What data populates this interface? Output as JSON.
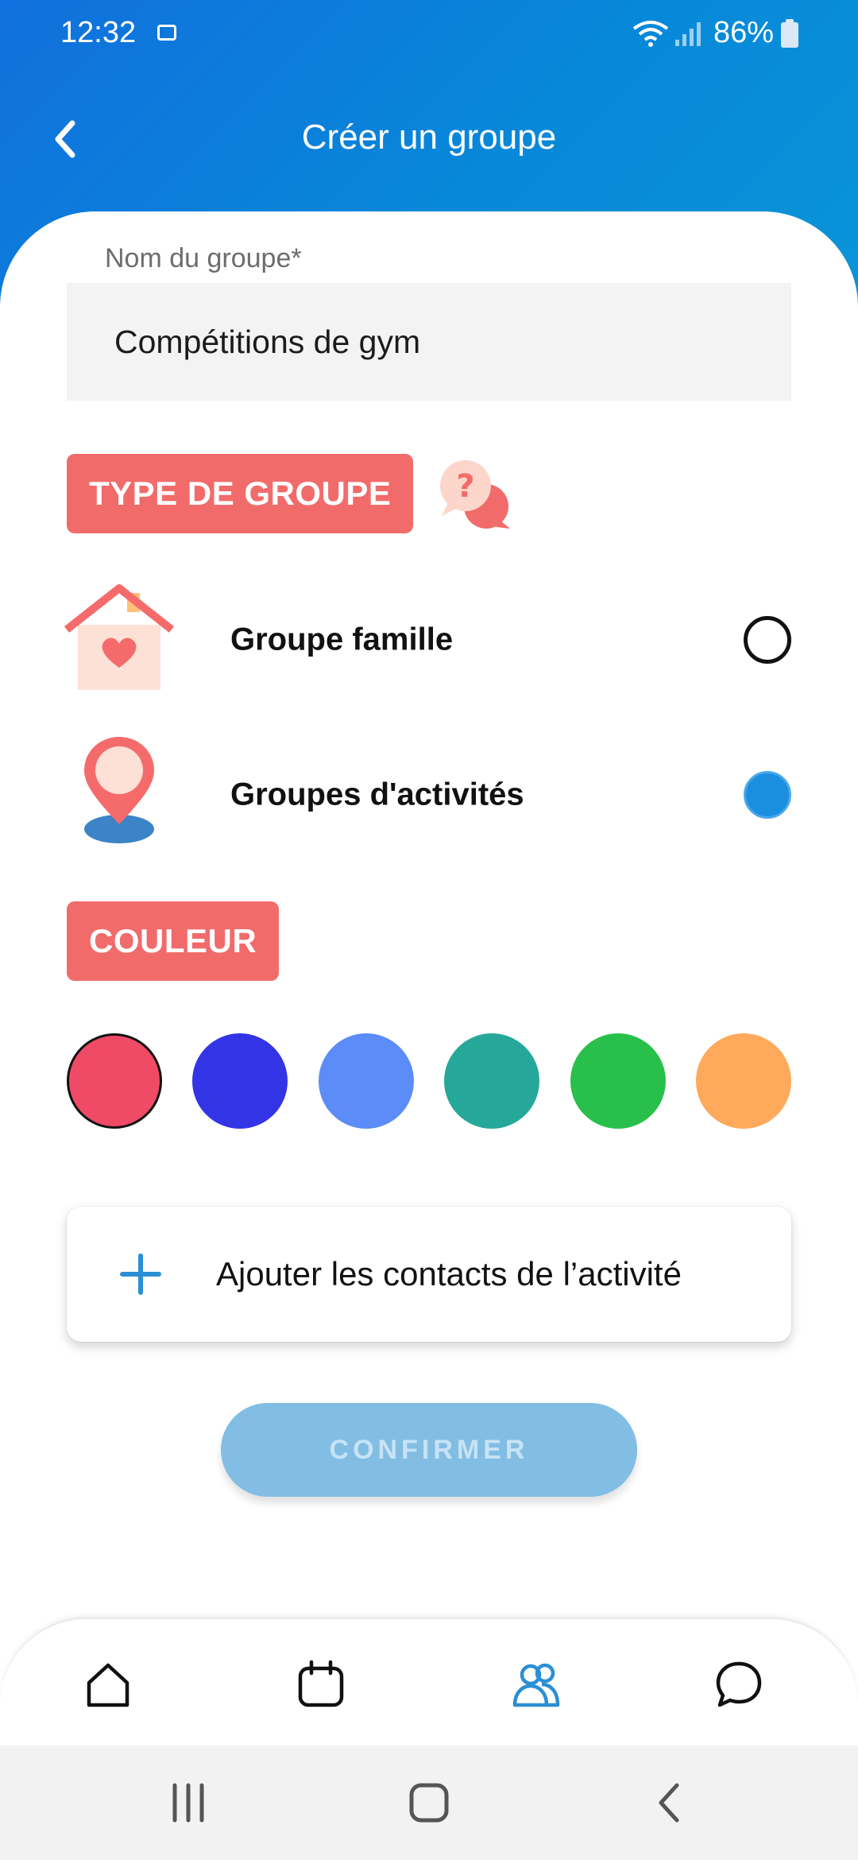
{
  "status_bar": {
    "time": "12:32",
    "battery_percent": "86%"
  },
  "header": {
    "title": "Créer un groupe"
  },
  "group_name": {
    "label": "Nom du groupe*",
    "value": "Compétitions de gym"
  },
  "group_type": {
    "section_label": "TYPE DE GROUPE",
    "options": [
      {
        "label": "Groupe famille",
        "selected": false
      },
      {
        "label": "Groupes d'activités",
        "selected": true
      }
    ]
  },
  "color": {
    "section_label": "COULEUR",
    "swatches": [
      "#ef4a66",
      "#3234e6",
      "#5b8cf8",
      "#25a89a",
      "#28c04a",
      "#ffa95c"
    ],
    "selected_index": 0
  },
  "add_contacts": {
    "label": "Ajouter les contacts de l’activité"
  },
  "confirm": {
    "label": "CONFIRMER"
  },
  "bottom_nav": {
    "items": [
      "home-icon",
      "calendar-icon",
      "groups-icon",
      "chat-icon"
    ],
    "active_index": 2,
    "active_color": "#2a8fd4"
  }
}
